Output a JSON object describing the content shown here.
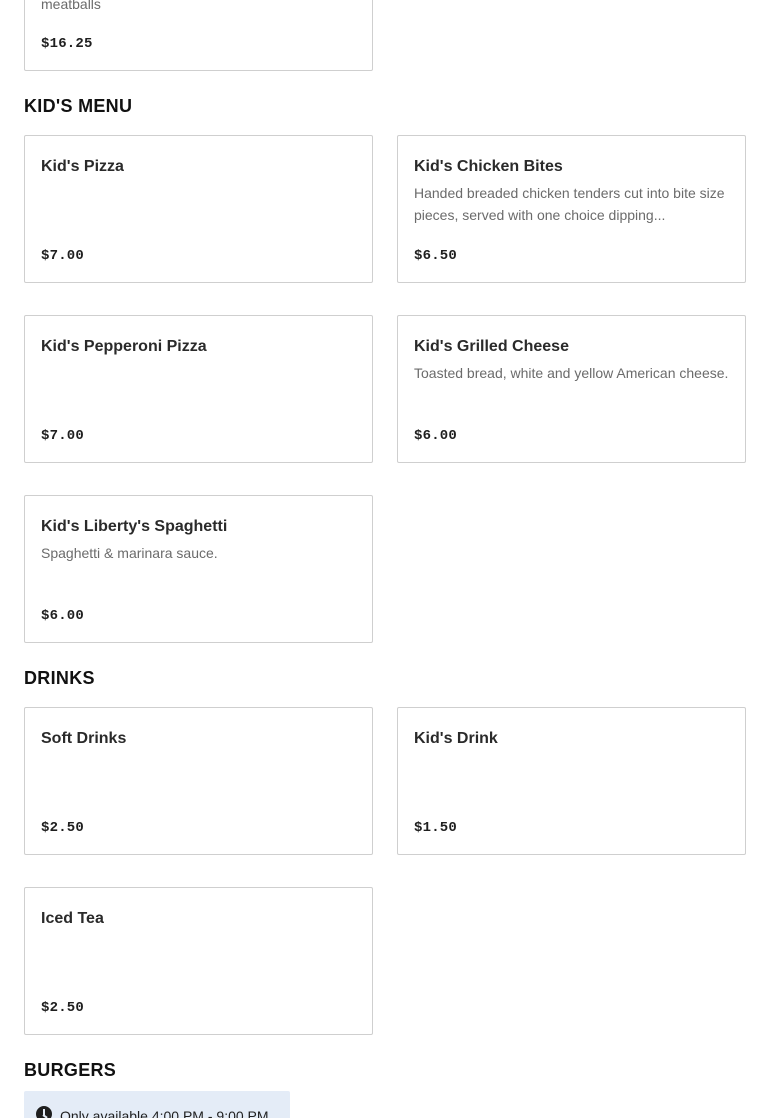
{
  "top_card": {
    "desc_tail": "meatballs",
    "price": "$16.25"
  },
  "sections": {
    "kids": {
      "title": "KID'S MENU",
      "items": [
        {
          "name": "Kid's Pizza",
          "desc": "",
          "price": "$7.00"
        },
        {
          "name": "Kid's Chicken Bites",
          "desc": "Handed breaded chicken tenders cut into bite size pieces, served with one choice dipping...",
          "price": "$6.50"
        },
        {
          "name": "Kid's Pepperoni Pizza",
          "desc": "",
          "price": "$7.00"
        },
        {
          "name": "Kid's Grilled Cheese",
          "desc": "Toasted bread, white and yellow American cheese.",
          "price": "$6.00"
        },
        {
          "name": "Kid's Liberty's Spaghetti",
          "desc": "Spaghetti & marinara sauce.",
          "price": "$6.00"
        }
      ]
    },
    "drinks": {
      "title": "DRINKS",
      "items": [
        {
          "name": "Soft Drinks",
          "desc": "",
          "price": "$2.50"
        },
        {
          "name": "Kid's Drink",
          "desc": "",
          "price": "$1.50"
        },
        {
          "name": "Iced Tea",
          "desc": "",
          "price": "$2.50"
        }
      ]
    },
    "burgers": {
      "title": "BURGERS",
      "availability": "Only available 4:00 PM - 9:00 PM",
      "availability_icon": "clock-icon"
    }
  }
}
